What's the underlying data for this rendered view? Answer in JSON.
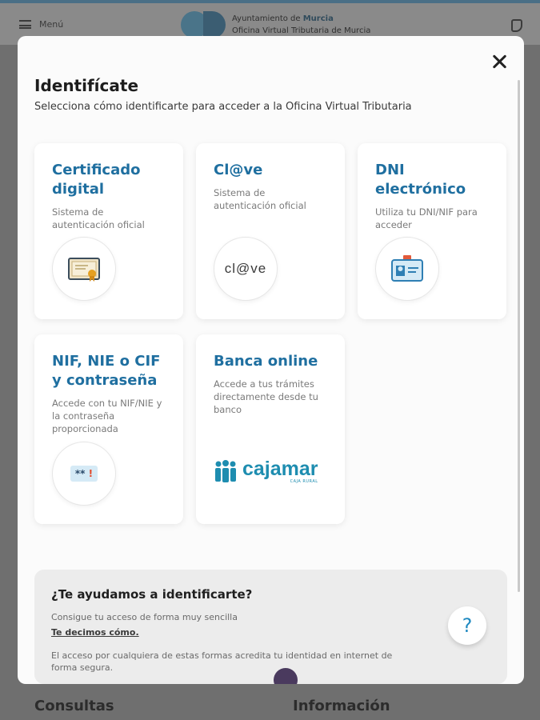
{
  "background": {
    "menu_label": "Menú",
    "org_name_prefix": "Ayuntamiento de",
    "org_name_city": "Murcia",
    "org_subtitle": "Oficina Virtual Tributaria de Murcia",
    "footer_left": "Consultas",
    "footer_right": "Información"
  },
  "modal": {
    "title": "Identifícate",
    "subtitle": "Selecciona cómo identificarte para acceder a la Oficina Virtual Tributaria",
    "cards": [
      {
        "title": "Certificado digital",
        "desc": "Sistema de autenticación oficial",
        "icon": "certificate-icon"
      },
      {
        "title": "Cl@ve",
        "desc": "Sistema de autenticación oficial",
        "icon": "clave-logo",
        "logo_text": "cl@ve"
      },
      {
        "title": "DNI electrónico",
        "desc": "Utiliza tu DNI/NIF para acceder",
        "icon": "id-card-icon"
      },
      {
        "title": "NIF, NIE o CIF y contraseña",
        "desc": "Accede con tu NIF/NIE y la contraseña proporcionada",
        "icon": "password-icon"
      },
      {
        "title": "Banca online",
        "desc": "Accede a tus trámites directamente desde tu banco",
        "icon": "cajamar-logo",
        "logo_text": "cajamar",
        "logo_sub": "CAJA RURAL"
      }
    ],
    "help": {
      "title": "¿Te ayudamos a identificarte?",
      "text": "Consigue tu acceso de forma muy sencilla",
      "link": "Te decimos cómo.",
      "note": "El acceso por cualquiera de estas formas acredita tu identidad en internet de forma segura.",
      "button": "?"
    }
  },
  "colors": {
    "card_title": "#1f6fa0",
    "cajamar": "#1e8db0"
  }
}
